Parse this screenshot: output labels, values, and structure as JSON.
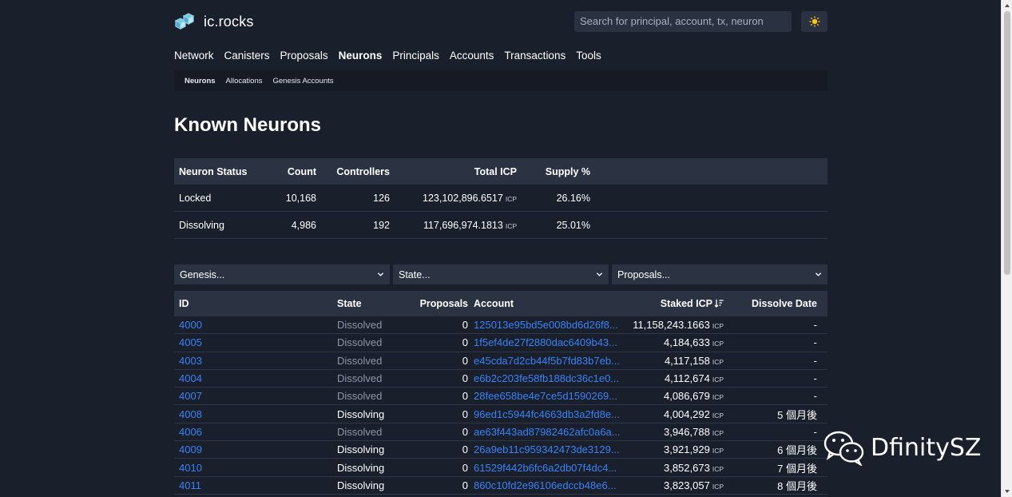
{
  "header": {
    "logo_text": "ic.rocks",
    "search_placeholder": "Search for principal, account, tx, neuron",
    "theme_icon": "sun-icon"
  },
  "nav": [
    "Network",
    "Canisters",
    "Proposals",
    "Neurons",
    "Principals",
    "Accounts",
    "Transactions",
    "Tools"
  ],
  "nav_active": "Neurons",
  "subnav": [
    "Neurons",
    "Allocations",
    "Genesis Accounts"
  ],
  "page_title": "Known Neurons",
  "summary": {
    "headers": [
      "Neuron Status",
      "Count",
      "Controllers",
      "Total ICP",
      "Supply %"
    ],
    "rows": [
      {
        "status": "Locked",
        "count": "10,168",
        "controllers": "126",
        "total": "123,102,896.6517",
        "unit": "ICP",
        "supply": "26.16%"
      },
      {
        "status": "Dissolving",
        "count": "4,986",
        "controllers": "192",
        "total": "117,696,974.1813",
        "unit": "ICP",
        "supply": "25.01%"
      }
    ]
  },
  "filters": [
    "Genesis...",
    "State...",
    "Proposals..."
  ],
  "table": {
    "headers": [
      "ID",
      "State",
      "Proposals",
      "Account",
      "Staked ICP",
      "Dissolve Date"
    ],
    "unit": "ICP",
    "rows": [
      {
        "id": "4000",
        "state": "Dissolved",
        "proposals": "0",
        "account": "125013e95bd5e008bd6d26f8...",
        "staked": "11,158,243.1663",
        "dissolve": "-"
      },
      {
        "id": "4005",
        "state": "Dissolved",
        "proposals": "0",
        "account": "1f5ef4de27f2880dac6409b43...",
        "staked": "4,184,633",
        "dissolve": "-"
      },
      {
        "id": "4003",
        "state": "Dissolved",
        "proposals": "0",
        "account": "e45cda7d2cb44f5b7fd83b7eb...",
        "staked": "4,117,158",
        "dissolve": "-"
      },
      {
        "id": "4004",
        "state": "Dissolved",
        "proposals": "0",
        "account": "e6b2c203fe58fb188dc36c1e0...",
        "staked": "4,112,674",
        "dissolve": "-"
      },
      {
        "id": "4007",
        "state": "Dissolved",
        "proposals": "0",
        "account": "28fee658be4e7ce5d1590269...",
        "staked": "4,086,679",
        "dissolve": "-"
      },
      {
        "id": "4008",
        "state": "Dissolving",
        "proposals": "0",
        "account": "96ed1c5944fc4663db3a2fd8e...",
        "staked": "4,004,292",
        "dissolve": "5 個月後"
      },
      {
        "id": "4006",
        "state": "Dissolved",
        "proposals": "0",
        "account": "ae63f443ad87982462afc0a6a...",
        "staked": "3,946,788",
        "dissolve": "-"
      },
      {
        "id": "4009",
        "state": "Dissolving",
        "proposals": "0",
        "account": "26a9eb11c959342473de3129...",
        "staked": "3,921,929",
        "dissolve": "6 個月後"
      },
      {
        "id": "4010",
        "state": "Dissolving",
        "proposals": "0",
        "account": "61529f442b6fc6a2db07f4dc4...",
        "staked": "3,852,673",
        "dissolve": "7 個月後"
      },
      {
        "id": "4011",
        "state": "Dissolving",
        "proposals": "0",
        "account": "860c10fd2e96106edccb48e6...",
        "staked": "3,823,057",
        "dissolve": "8 個月後"
      }
    ]
  },
  "watermark": "DfinitySZ",
  "colors": {
    "background": "#1a1f2c",
    "header_row": "#2b3242",
    "link": "#3b82f6",
    "sun": "#f5c518"
  }
}
